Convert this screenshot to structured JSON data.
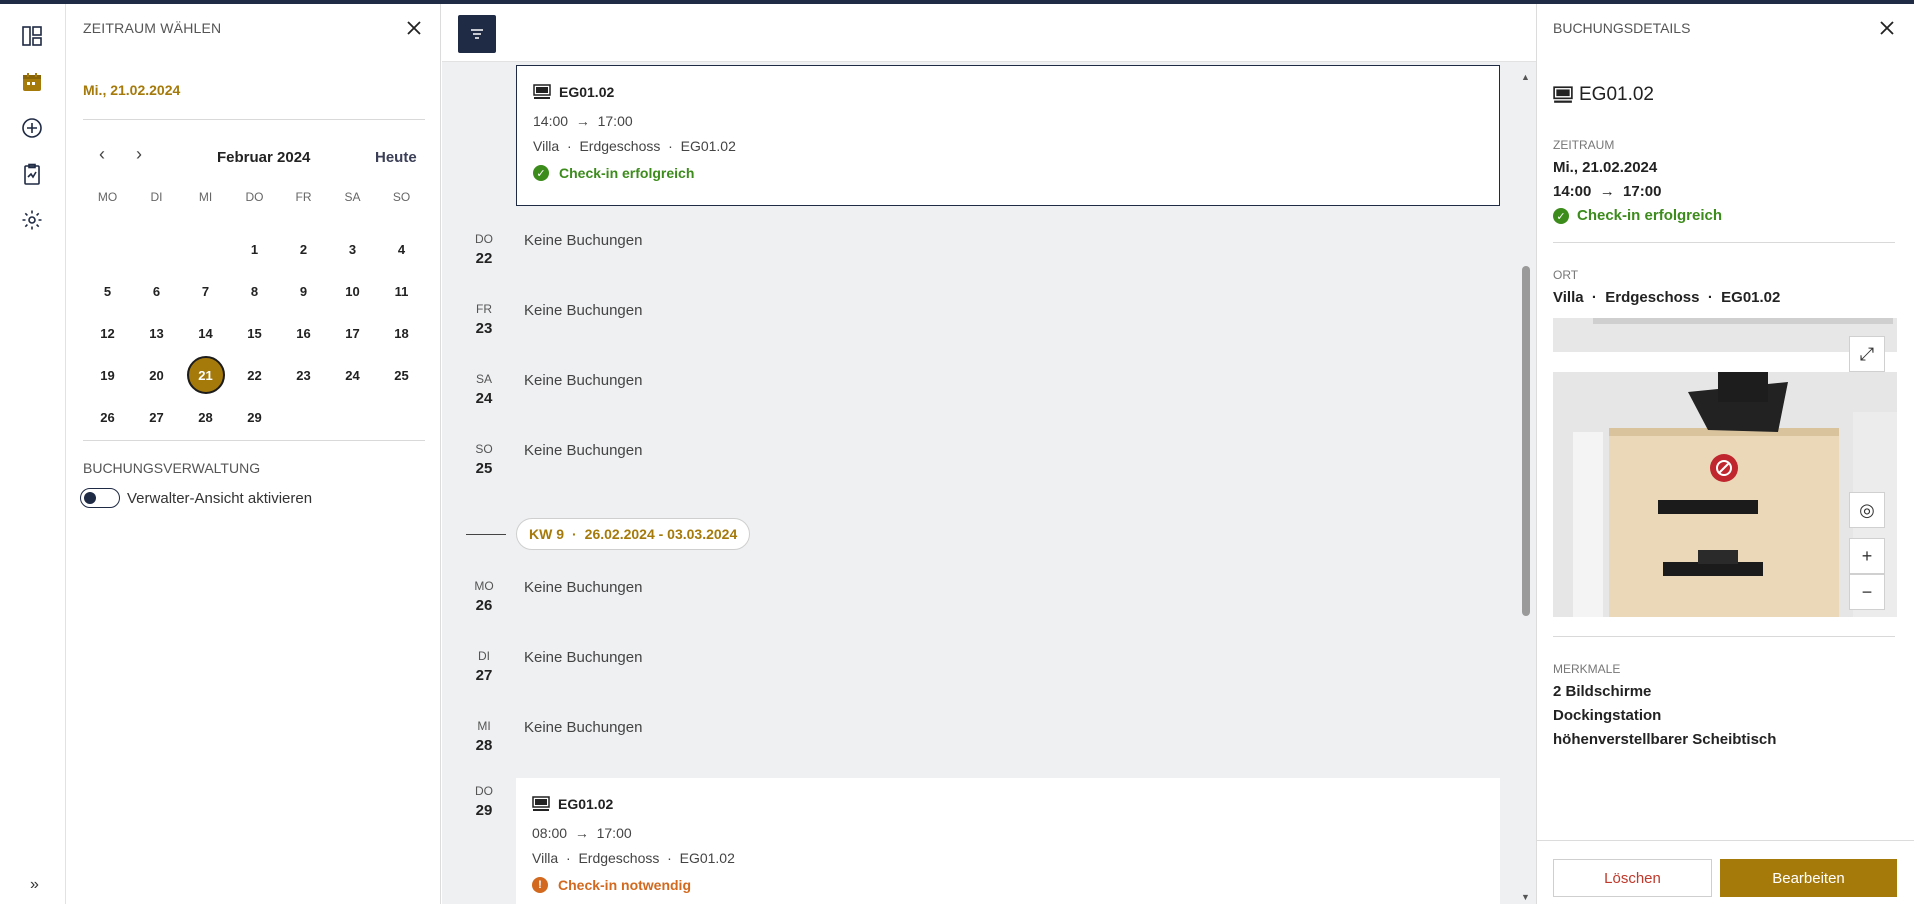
{
  "colors": {
    "accent": "#a57a0b",
    "navy": "#1f2a44",
    "success": "#3c8c1c",
    "warning": "#d2691e"
  },
  "datepanel": {
    "title": "ZEITRAUM WÄHLEN",
    "selected_date": "Mi., 21.02.2024",
    "month_label": "Februar 2024",
    "today_label": "Heute",
    "weekdays": [
      "MO",
      "DI",
      "MI",
      "DO",
      "FR",
      "SA",
      "SO"
    ],
    "selected_day": "21",
    "management_title": "BUCHUNGSVERWALTUNG",
    "toggle_label": "Verwalter-Ansicht aktivieren"
  },
  "list": {
    "top_card": {
      "name": "EG01.02",
      "time_from": "14:00",
      "time_to": "17:00",
      "building": "Villa",
      "floor": "Erdgeschoss",
      "room": "EG01.02",
      "status": "Check-in erfolgreich"
    },
    "days": [
      {
        "weekday": "DO",
        "day": "22",
        "text": "Keine Buchungen"
      },
      {
        "weekday": "FR",
        "day": "23",
        "text": "Keine Buchungen"
      },
      {
        "weekday": "SA",
        "day": "24",
        "text": "Keine Buchungen"
      },
      {
        "weekday": "SO",
        "day": "25",
        "text": "Keine Buchungen"
      }
    ],
    "week": {
      "label": "KW 9",
      "range": "26.02.2024 - 03.03.2024"
    },
    "days2": [
      {
        "weekday": "MO",
        "day": "26",
        "text": "Keine Buchungen"
      },
      {
        "weekday": "DI",
        "day": "27",
        "text": "Keine Buchungen"
      },
      {
        "weekday": "MI",
        "day": "28",
        "text": "Keine Buchungen"
      }
    ],
    "bottom_day": {
      "weekday": "DO",
      "day": "29"
    },
    "bottom_card": {
      "name": "EG01.02",
      "time_from": "08:00",
      "time_to": "17:00",
      "building": "Villa",
      "floor": "Erdgeschoss",
      "room": "EG01.02",
      "status": "Check-in notwendig"
    }
  },
  "details": {
    "title": "BUCHUNGSDETAILS",
    "name": "EG01.02",
    "period_label": "ZEITRAUM",
    "date": "Mi., 21.02.2024",
    "time_from": "14:00",
    "time_to": "17:00",
    "status": "Check-in erfolgreich",
    "location_label": "ORT",
    "building": "Villa",
    "floor": "Erdgeschoss",
    "room": "EG01.02",
    "features_label": "MERKMALE",
    "features": [
      "2 Bildschirme",
      "Dockingstation",
      "höhenverstellbarer Scheibtisch"
    ],
    "delete_label": "Löschen",
    "edit_label": "Bearbeiten"
  }
}
